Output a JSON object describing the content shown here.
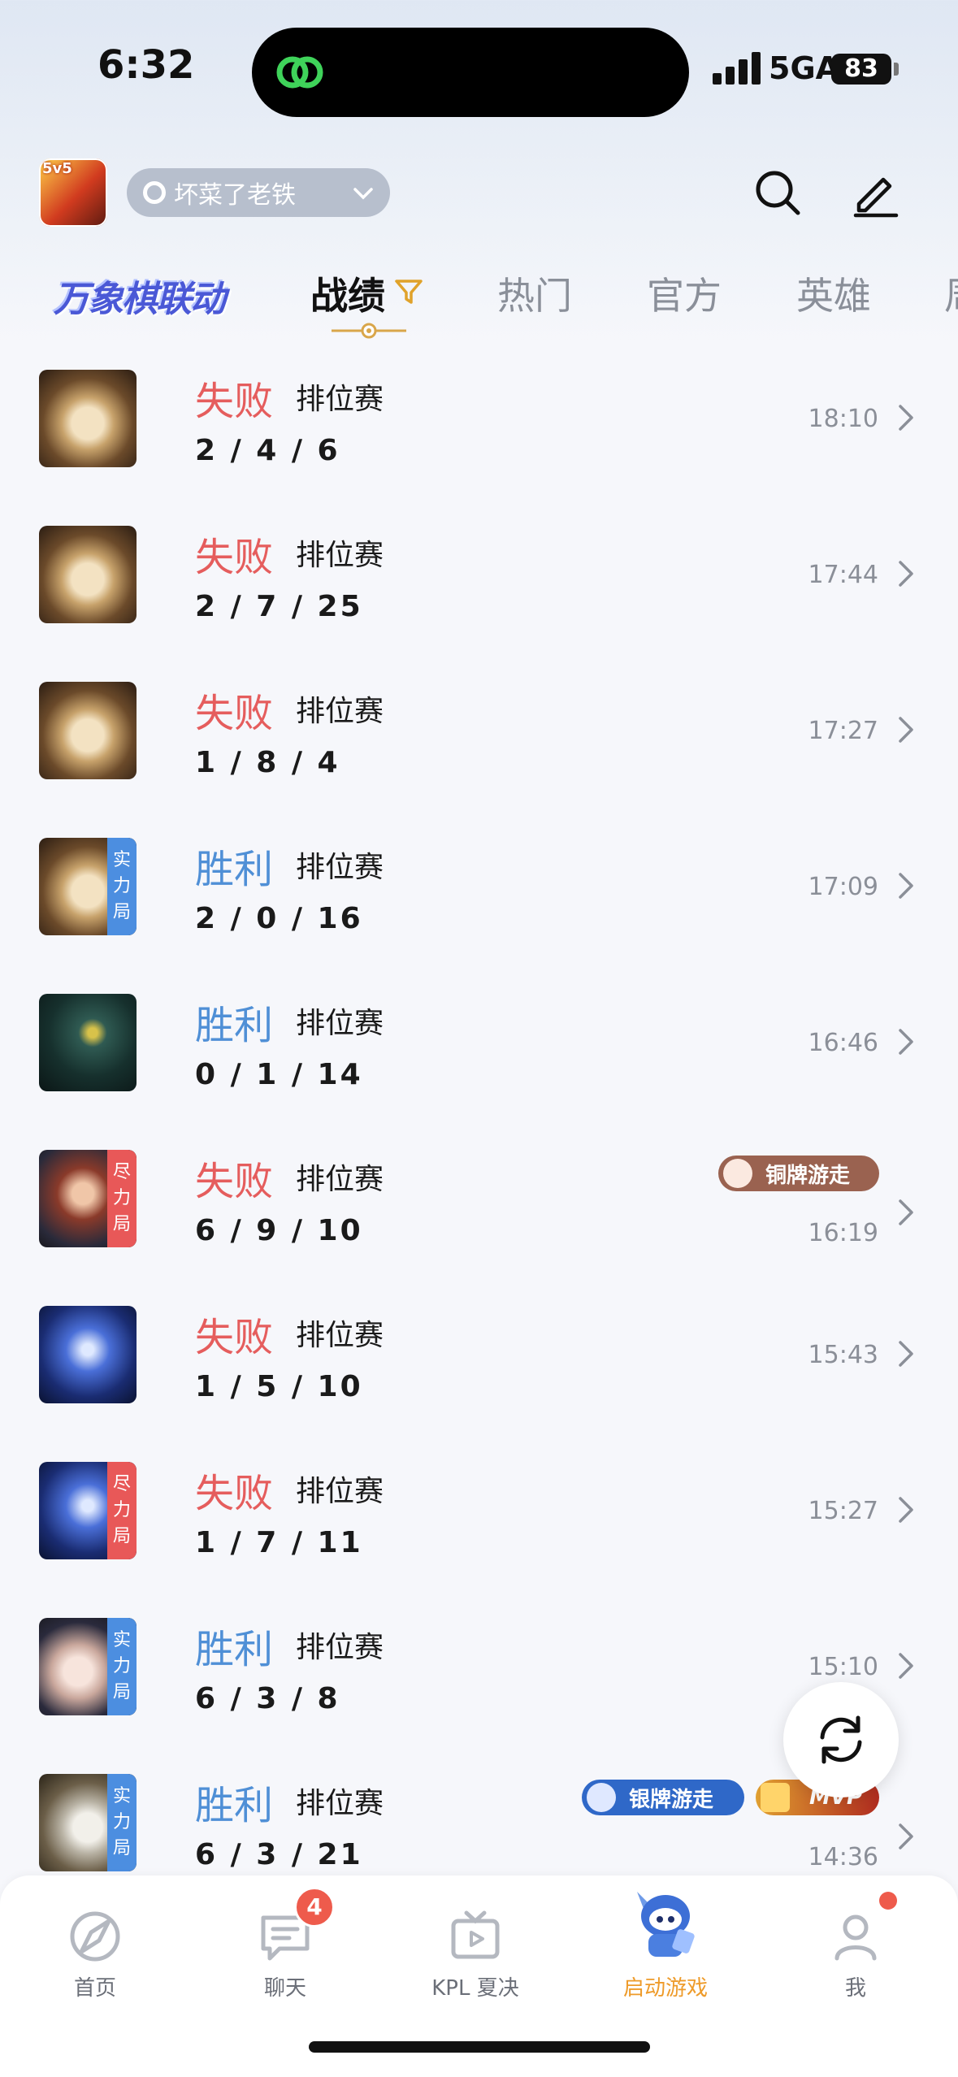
{
  "status_bar": {
    "time": "6:32",
    "network": "5GA",
    "battery": "83"
  },
  "header": {
    "account_name": "坏菜了老铁",
    "game_logo_text": "5v5"
  },
  "tabs": {
    "collab": "万象棋联动",
    "items": [
      {
        "label": "战绩",
        "active": true
      },
      {
        "label": "热门"
      },
      {
        "label": "官方"
      },
      {
        "label": "英雄"
      },
      {
        "label": "周"
      }
    ]
  },
  "matches": [
    {
      "result": "失败",
      "outcome": "lose",
      "mode": "排位赛",
      "kda": "2 / 4 / 6",
      "time": "18:10",
      "tag": "",
      "hero": "hero-elder-1"
    },
    {
      "result": "失败",
      "outcome": "lose",
      "mode": "排位赛",
      "kda": "2 / 7 / 25",
      "time": "17:44",
      "tag": "",
      "hero": "hero-elder-1"
    },
    {
      "result": "失败",
      "outcome": "lose",
      "mode": "排位赛",
      "kda": "1 / 8 / 4",
      "time": "17:27",
      "tag": "",
      "hero": "hero-elder-1"
    },
    {
      "result": "胜利",
      "outcome": "win",
      "mode": "排位赛",
      "kda": "2 / 0 / 16",
      "time": "17:09",
      "tag": "实力局",
      "tag_color": "blue",
      "hero": "hero-elder-1"
    },
    {
      "result": "胜利",
      "outcome": "win",
      "mode": "排位赛",
      "kda": "0 / 1 / 14",
      "time": "16:46",
      "tag": "",
      "hero": "hero-mech"
    },
    {
      "result": "失败",
      "outcome": "lose",
      "mode": "排位赛",
      "kda": "6 / 9 / 10",
      "time": "16:19",
      "tag": "尽力局",
      "tag_color": "red",
      "hero": "hero-warrior",
      "badge": "铜牌游走"
    },
    {
      "result": "失败",
      "outcome": "lose",
      "mode": "排位赛",
      "kda": "1 / 5 / 10",
      "time": "15:43",
      "tag": "",
      "hero": "hero-blue"
    },
    {
      "result": "失败",
      "outcome": "lose",
      "mode": "排位赛",
      "kda": "1 / 7 / 11",
      "time": "15:27",
      "tag": "尽力局",
      "tag_color": "red",
      "hero": "hero-blue"
    },
    {
      "result": "胜利",
      "outcome": "win",
      "mode": "排位赛",
      "kda": "6 / 3 / 8",
      "time": "15:10",
      "tag": "实力局",
      "tag_color": "blue",
      "hero": "hero-girl"
    },
    {
      "result": "胜利",
      "outcome": "win",
      "mode": "排位赛",
      "kda": "6 / 3 / 21",
      "time": "14:36",
      "tag": "实力局",
      "tag_color": "blue",
      "hero": "hero-sage",
      "badge": "银牌游走",
      "mvp": "MVP"
    }
  ],
  "bottom_nav": [
    {
      "label": "首页",
      "icon": "compass-icon"
    },
    {
      "label": "聊天",
      "icon": "chat-icon",
      "badge": "4"
    },
    {
      "label": "KPL 夏决",
      "icon": "tv-icon"
    },
    {
      "label": "启动游戏",
      "icon": "mascot-icon"
    },
    {
      "label": "我",
      "icon": "profile-icon"
    }
  ],
  "colors": {
    "lose": "#e55d5d",
    "win": "#4f8fd6",
    "highlight": "#ee9b2a"
  }
}
